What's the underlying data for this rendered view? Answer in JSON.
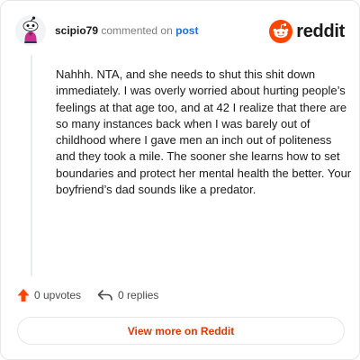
{
  "header": {
    "username": "scipio79",
    "action": "commented on",
    "post_link": "post",
    "brand": "reddit"
  },
  "comment": {
    "text": "Nahhh. NTA, and she needs to shut this shit down immediately. I was overly worried about hurting people’s feelings at that age too, and at 42 I realize that there are so many instances back when I was barely out of childhood where I gave men an inch out of politeness and they took a mile. The sooner she learns how to set boundaries and protect her mental health the better. Your boyfriend’s dad sounds like a predator."
  },
  "actions": {
    "upvotes": "0 upvotes",
    "replies": "0 replies"
  },
  "view_more": "View more on Reddit",
  "colors": {
    "upvote": "#ff4500",
    "view_more": "#d93a00",
    "post_link": "#1e6fd9",
    "reddit_orange": "#ff4500"
  },
  "icons": {
    "avatar": "snoo-avatar",
    "brand": "reddit-logo-icon",
    "upvote": "upvote-arrow-icon",
    "reply": "reply-arrow-icon"
  }
}
